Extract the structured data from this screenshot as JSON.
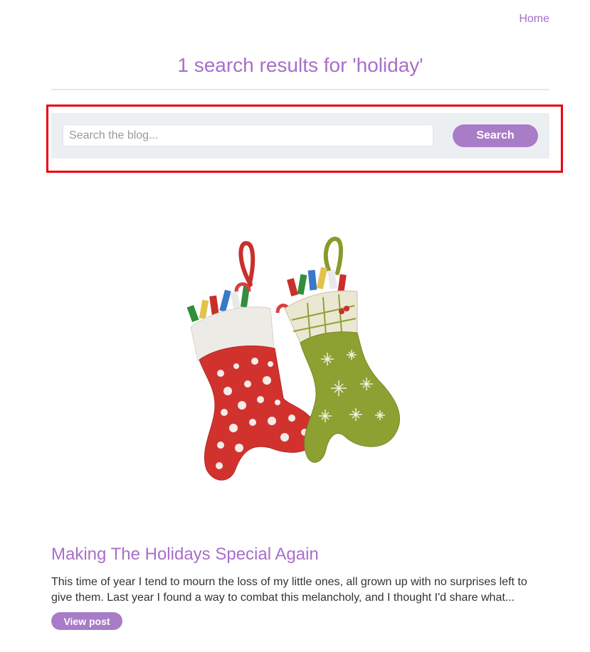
{
  "nav": {
    "home_label": "Home"
  },
  "page": {
    "title": "1 search results for 'holiday'"
  },
  "search": {
    "placeholder": "Search the blog...",
    "value": "",
    "button_label": "Search"
  },
  "results": [
    {
      "image_icon": "christmas-stockings-image",
      "title": "Making The Holidays Special Again",
      "excerpt": "This time of year I tend to mourn the loss of my little ones, all grown up with no surprises left to give them. Last year I found a way to combat this melancholy, and I thought I'd share what...",
      "button_label": "View post"
    }
  ],
  "colors": {
    "accent": "#a86fc9",
    "button": "#a97cc8",
    "search_bg": "#eceff2",
    "highlight": "#e8000b",
    "text": "#333333"
  }
}
